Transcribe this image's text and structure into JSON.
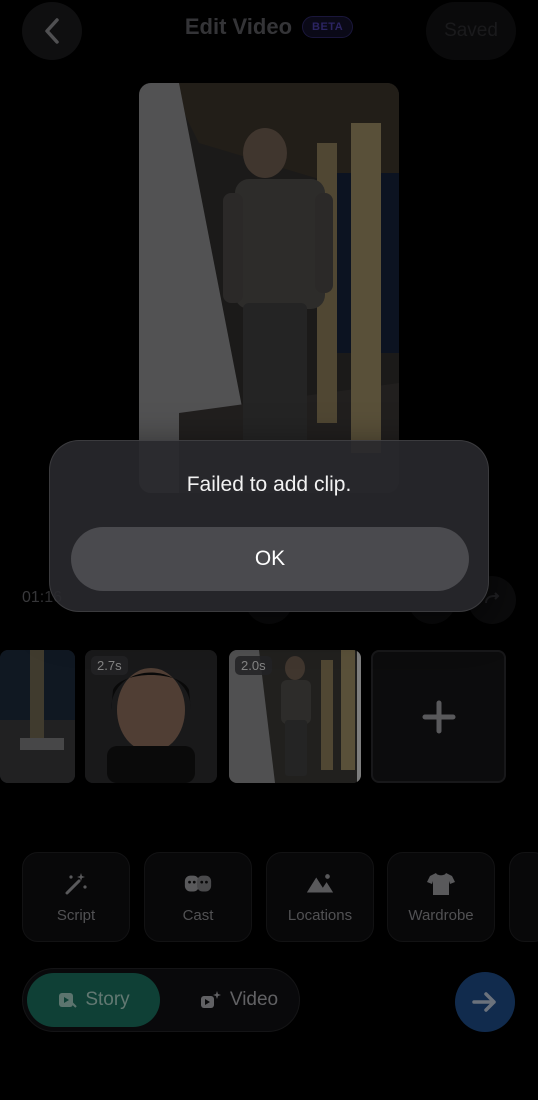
{
  "header": {
    "back_icon": "chevron-left-icon",
    "title": "Edit Video",
    "badge": "BETA",
    "saved_label": "Saved"
  },
  "preview": {
    "description_icon": "video-frame"
  },
  "playback": {
    "timecode": "01:16"
  },
  "clips": [
    {
      "duration": ""
    },
    {
      "duration": "2.7s"
    },
    {
      "duration": "2.0s"
    }
  ],
  "tools": [
    {
      "label": "Script",
      "icon": "magic-wand-icon"
    },
    {
      "label": "Cast",
      "icon": "cast-faces-icon"
    },
    {
      "label": "Locations",
      "icon": "mountains-icon"
    },
    {
      "label": "Wardrobe",
      "icon": "tshirt-icon"
    }
  ],
  "mode_toggle": {
    "story_label": "Story",
    "video_label": "Video",
    "active": "Story"
  },
  "alert": {
    "message": "Failed to add clip.",
    "ok_label": "OK"
  },
  "colors": {
    "accent_green": "#1a6f5e",
    "accent_blue": "#1e4b86",
    "badge_purple": "#4b3ea8"
  }
}
